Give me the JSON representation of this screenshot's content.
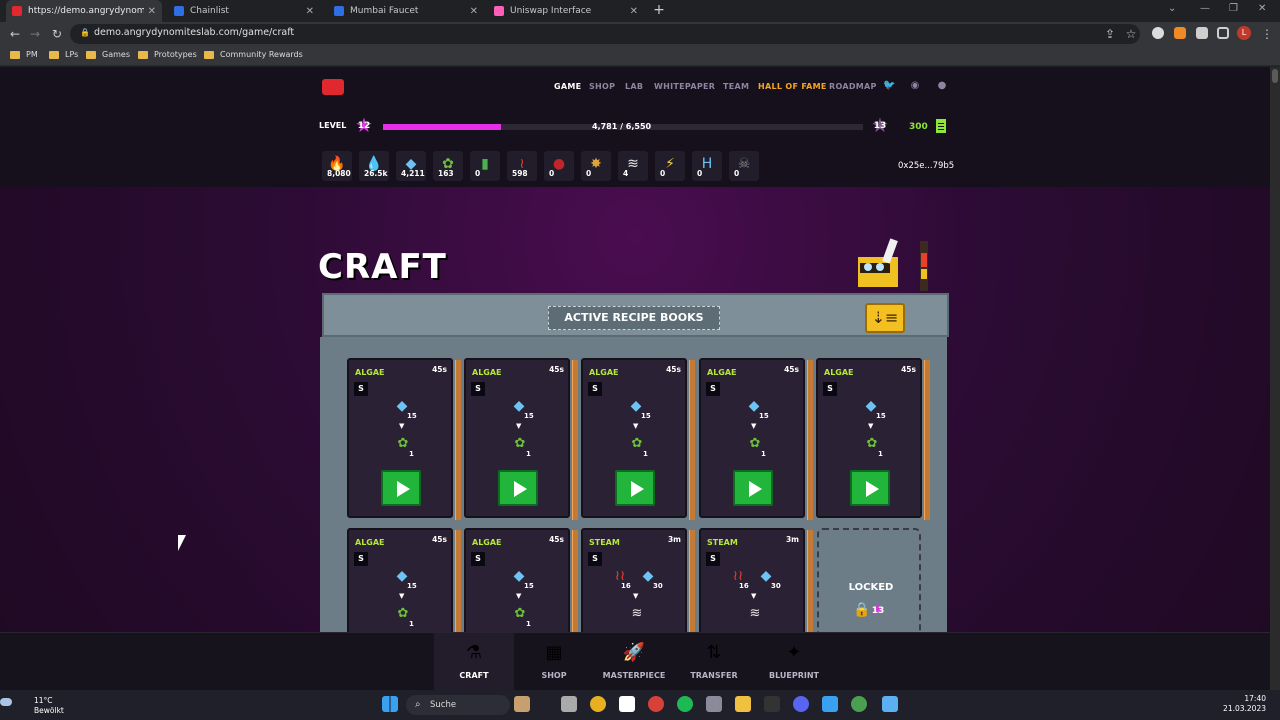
{
  "browser": {
    "tabs": [
      {
        "label": "https://demo.angrydynomiteslab.c",
        "active": true,
        "favicon_color": "#e0282e"
      },
      {
        "label": "Chainlist",
        "active": false,
        "favicon_color": "#2f6fe3"
      },
      {
        "label": "Mumbai Faucet",
        "active": false,
        "favicon_color": "#2f6fe3"
      },
      {
        "label": "Uniswap Interface",
        "active": false,
        "favicon_color": "#ff5fb6"
      }
    ],
    "url": "demo.angrydynomiteslab.com/game/craft",
    "bookmarks": [
      "PM",
      "LPs",
      "Games",
      "Prototypes",
      "Community Rewards"
    ],
    "profile_initial": "L"
  },
  "game": {
    "nav": [
      "GAME",
      "SHOP",
      "LAB",
      "WHITEPAPER",
      "TEAM",
      "HALL OF FAME",
      "ROADMAP"
    ],
    "level_label": "LEVEL",
    "level": "12",
    "next_level": "13",
    "xp_text": "4,781 / 6,550",
    "xp_progress": 0.245,
    "energy": "300",
    "wallet": "0x25e...79b5",
    "resources": [
      {
        "icon": "fire-icon",
        "value": "8,080",
        "color": "#f05a28",
        "glyph": "🔥"
      },
      {
        "icon": "water-icon",
        "value": "26.5k",
        "color": "#3aa0f0",
        "glyph": "💧"
      },
      {
        "icon": "crystal-icon",
        "value": "4,211",
        "color": "#6ec3f5",
        "glyph": "◆"
      },
      {
        "icon": "algae-icon",
        "value": "163",
        "color": "#6fbf3c",
        "glyph": "✿"
      },
      {
        "icon": "oxygen-tank-icon",
        "value": "0",
        "color": "#4caf50",
        "glyph": "▮"
      },
      {
        "icon": "heat-icon",
        "value": "598",
        "color": "#e8402a",
        "glyph": "≀"
      },
      {
        "icon": "ore-icon",
        "value": "0",
        "color": "#c0252a",
        "glyph": "●"
      },
      {
        "icon": "sulfur-icon",
        "value": "0",
        "color": "#e0a33a",
        "glyph": "✸"
      },
      {
        "icon": "steam-icon",
        "value": "4",
        "color": "#e8e8e8",
        "glyph": "≋"
      },
      {
        "icon": "lightning-icon",
        "value": "0",
        "color": "#f4d03f",
        "glyph": "⚡"
      },
      {
        "icon": "hydrogen-icon",
        "value": "0",
        "color": "#6ec3f5",
        "glyph": "H"
      },
      {
        "icon": "skull-icon",
        "value": "0",
        "color": "#888888",
        "glyph": "☠"
      }
    ],
    "page_title": "CRAFT",
    "section_title": "ACTIVE RECIPE BOOKS",
    "cards": [
      {
        "name": "ALGAE",
        "time": "45s",
        "badge": "S",
        "in_qty": "15",
        "in_qty2": "",
        "out_qty": "1"
      },
      {
        "name": "ALGAE",
        "time": "45s",
        "badge": "S",
        "in_qty": "15",
        "in_qty2": "",
        "out_qty": "1"
      },
      {
        "name": "ALGAE",
        "time": "45s",
        "badge": "S",
        "in_qty": "15",
        "in_qty2": "",
        "out_qty": "1"
      },
      {
        "name": "ALGAE",
        "time": "45s",
        "badge": "S",
        "in_qty": "15",
        "in_qty2": "",
        "out_qty": "1"
      },
      {
        "name": "ALGAE",
        "time": "45s",
        "badge": "S",
        "in_qty": "15",
        "in_qty2": "",
        "out_qty": "1"
      },
      {
        "name": "ALGAE",
        "time": "45s",
        "badge": "S",
        "in_qty": "15",
        "in_qty2": "",
        "out_qty": "1"
      },
      {
        "name": "ALGAE",
        "time": "45s",
        "badge": "S",
        "in_qty": "15",
        "in_qty2": "",
        "out_qty": "1"
      },
      {
        "name": "STEAM",
        "time": "3m",
        "badge": "S",
        "in_qty": "16",
        "in_qty2": "30",
        "out_qty": ""
      },
      {
        "name": "STEAM",
        "time": "3m",
        "badge": "S",
        "in_qty": "16",
        "in_qty2": "30",
        "out_qty": ""
      }
    ],
    "locked_label": "LOCKED",
    "locked_level": "13",
    "bottom_nav": [
      {
        "label": "CRAFT",
        "icon": "flask-icon",
        "glyph": "⚗",
        "active": true
      },
      {
        "label": "SHOP",
        "icon": "shop-icon",
        "glyph": "▦",
        "active": false
      },
      {
        "label": "MASTERPIECE",
        "icon": "rocket-icon",
        "glyph": "🚀",
        "active": false
      },
      {
        "label": "TRANSFER",
        "icon": "transfer-icon",
        "glyph": "⇅",
        "active": false
      },
      {
        "label": "BLUEPRINT",
        "icon": "blueprint-icon",
        "glyph": "✦",
        "active": false
      }
    ]
  },
  "taskbar": {
    "weather_temp": "11°C",
    "weather_desc": "Bewölkt",
    "search_label": "Suche",
    "time": "17:40",
    "date": "21.03.2023"
  }
}
